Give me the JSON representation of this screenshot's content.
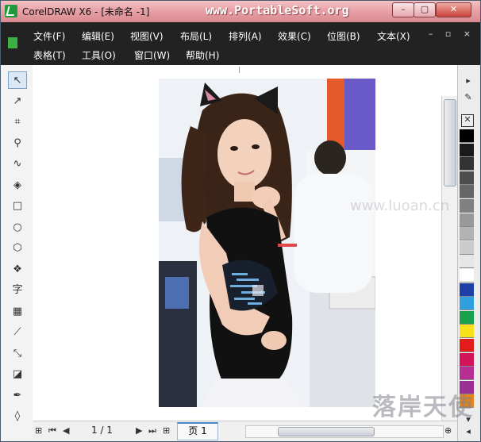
{
  "window": {
    "title": "CorelDRAW X6 - [未命名 -1]",
    "site": "www.PortableSoft.org"
  },
  "menubar": {
    "row1": [
      "文件(F)",
      "编辑(E)",
      "视图(V)",
      "布局(L)",
      "排列(A)",
      "效果(C)",
      "位图(B)",
      "文本(X)"
    ],
    "row2": [
      "表格(T)",
      "工具(O)",
      "窗口(W)",
      "帮助(H)"
    ]
  },
  "toolbox": {
    "tools": [
      {
        "name": "pick-tool-icon",
        "glyph": "↖"
      },
      {
        "name": "shape-tool-icon",
        "glyph": "↗"
      },
      {
        "name": "crop-tool-icon",
        "glyph": "⌗"
      },
      {
        "name": "zoom-tool-icon",
        "glyph": "⚲"
      },
      {
        "name": "freehand-tool-icon",
        "glyph": "∿"
      },
      {
        "name": "smart-fill-tool-icon",
        "glyph": "◈"
      },
      {
        "name": "rectangle-tool-icon",
        "glyph": "□"
      },
      {
        "name": "ellipse-tool-icon",
        "glyph": "○"
      },
      {
        "name": "polygon-tool-icon",
        "glyph": "⬡"
      },
      {
        "name": "basic-shapes-tool-icon",
        "glyph": "❖"
      },
      {
        "name": "text-tool-icon",
        "glyph": "字"
      },
      {
        "name": "table-tool-icon",
        "glyph": "▦"
      },
      {
        "name": "dimension-tool-icon",
        "glyph": "⟋"
      },
      {
        "name": "connector-tool-icon",
        "glyph": "⤡"
      },
      {
        "name": "interactive-effects-tool-icon",
        "glyph": "◪"
      },
      {
        "name": "eyedropper-tool-icon",
        "glyph": "✒"
      },
      {
        "name": "outline-tool-icon",
        "glyph": "◊"
      }
    ]
  },
  "palette": {
    "colors": [
      "#000000",
      "#1a1a1a",
      "#333333",
      "#4d4d4d",
      "#666666",
      "#808080",
      "#999999",
      "#b3b3b3",
      "#cccccc",
      "#e6e6e6",
      "#ffffff",
      "#1f3fa8",
      "#2f9fe0",
      "#1aa04a",
      "#f7e019",
      "#e21b1b",
      "#d4145a",
      "#b72e94",
      "#9c2f94",
      "#e5831c"
    ]
  },
  "pages": {
    "count": "1 / 1",
    "tab": "页 1"
  },
  "watermark": {
    "text": "落岸天使",
    "url": "www.luoan.cn"
  }
}
